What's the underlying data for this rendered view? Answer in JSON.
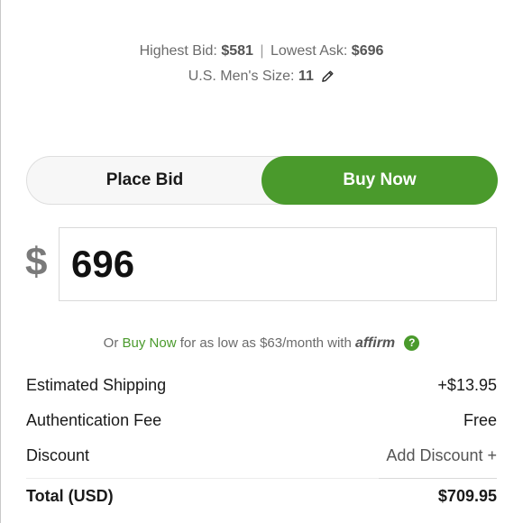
{
  "market": {
    "highest_bid_label": "Highest Bid:",
    "highest_bid_value": "$581",
    "separator": "|",
    "lowest_ask_label": "Lowest Ask:",
    "lowest_ask_value": "$696"
  },
  "size": {
    "label": "U.S. Men's Size:",
    "value": "11",
    "edit_icon": "pencil-icon"
  },
  "toggle": {
    "place_bid_label": "Place Bid",
    "buy_now_label": "Buy Now",
    "selected": "Buy Now"
  },
  "amount": {
    "currency_symbol": "$",
    "value": "696"
  },
  "financing": {
    "prefix": "Or",
    "link_text": "Buy Now",
    "middle": "for as low as $63/month with",
    "provider": "affirm",
    "help_icon": "question-icon"
  },
  "summary": {
    "shipping_label": "Estimated Shipping",
    "shipping_value": "+$13.95",
    "auth_label": "Authentication Fee",
    "auth_value": "Free",
    "discount_label": "Discount",
    "discount_action": "Add Discount +",
    "total_label": "Total (USD)",
    "total_value": "$709.95"
  },
  "colors": {
    "accent": "#4a9a2c",
    "text": "#1a1a1a",
    "muted": "#6b6b6b"
  }
}
